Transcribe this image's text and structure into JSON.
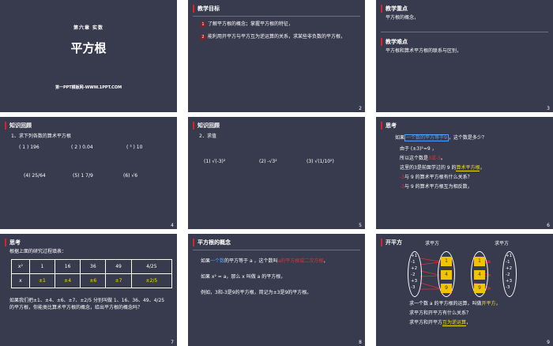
{
  "slides": [
    {
      "num": "",
      "chapter": "第六章 实数",
      "title": "平方根",
      "site": "第一PPT模板网-WWW.1PPT.COM"
    },
    {
      "num": "2",
      "header": "教学目标",
      "items": [
        "了解平方根的概念；掌握平方根的特征，",
        "能利用开平方与平方互为逆运算的关系，求某些非负数的平方根，"
      ],
      "badges": [
        "1",
        "2"
      ]
    },
    {
      "num": "3",
      "h1": "教学重点",
      "p1": "平方根的概念，",
      "h2": "教学难点",
      "p2": "平方根和算术平方根的联系与区别，"
    },
    {
      "num": "4",
      "header": "知识回顾",
      "line1": "1、求下列各数的算术平方根",
      "a": "( 1 ) 196",
      "b": "( 2 ) 0.04",
      "c": "( ³ ) 10",
      "d": "(4) 25/64",
      "e": "(5) 1 7/9",
      "f": "(6) √6"
    },
    {
      "num": "5",
      "header": "知识回顾",
      "line1": "2．求值",
      "a": "(1) √(-3)²",
      "b": "(2) -√3²",
      "c": "(3) √(1/10²)"
    },
    {
      "num": "6",
      "header": "思考",
      "l1a": "如果",
      "l1b": "一个数的平方等于9",
      "l1c": "，这个数是多少？",
      "l2": "由于  (±3)²=9  ，",
      "l3a": "所以这个数是",
      "l3b": "3或-3",
      "l3c": "。",
      "l4a": "这里的3是前面学过的 9 的",
      "l4b": "算术平方根",
      "l4c": "，",
      "l5a": "-3",
      "l5b": "与 9 的算术平方根有什么关系？",
      "l6a": "-3",
      "l6b": "与 9 的算术平方根互为相反数，"
    },
    {
      "num": "7",
      "header": "思考",
      "line1": "根据上面的研究过程填表：",
      "row1": [
        "x²",
        "1",
        "16",
        "36",
        "49",
        "4/25"
      ],
      "row2": [
        "x",
        "±1",
        "±4",
        "±6",
        "±7",
        "±2/5"
      ],
      "line2": "如果我们把±1、±4、±6、±7、±2/5 分别叫做 1、16、36、49、4/25的平方根，你能类比算术平方根的概念，给出平方根的概念吗？"
    },
    {
      "num": "8",
      "header": "平方根的概念",
      "l1a": "如果",
      "l1b": "一个数",
      "l1c": "的平方等于 a ，这个数叫",
      "l1d": "a的平方根或二次方根",
      "l1e": "，",
      "l2": "如果 x² = a，那么 x 叫做 a 的平方根，",
      "l3": "例如，3和-3是9的平方根，简记为±3是9的平方根。"
    },
    {
      "num": "9",
      "header": "开平方",
      "lab1": "求平方",
      "lab2": "求平方",
      "left1": [
        "+1",
        "-1",
        "+2",
        "-2",
        "+3",
        "-3"
      ],
      "mid1": [
        "1",
        "4",
        "9"
      ],
      "left2": [
        "+1",
        "-1",
        "+2",
        "-2",
        "+3",
        "-3"
      ],
      "mid2": [
        "1",
        "4",
        "9"
      ],
      "l1a": "求一个数 a 的平方根的运算，叫做",
      "l1b": "开平方",
      "l1c": "，",
      "l2": "求平方和开平方有什么关系？",
      "l3a": "求平方和开平方",
      "l3b": "互为逆运算",
      "l3c": "，"
    }
  ]
}
